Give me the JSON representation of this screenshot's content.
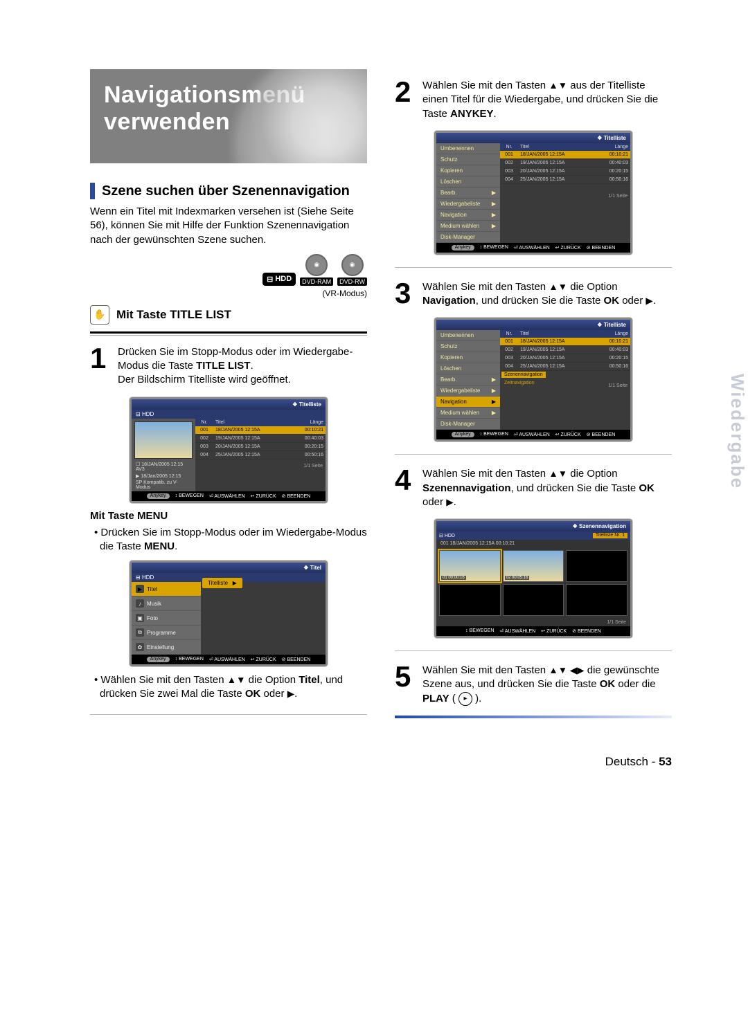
{
  "title_lines": "Navigationsmenü\nverwenden",
  "section": {
    "title": "Szene suchen über Szenennavigation",
    "intro": "Wenn ein Titel mit Indexmarken versehen ist (Siehe Seite 56), können Sie mit Hilfe der Funktion Szenennavigation nach der gewünschten Szene suchen."
  },
  "discs": {
    "hdd": "HDD",
    "ram": "DVD-RAM",
    "rw": "DVD-RW",
    "vr": "(VR-Modus)"
  },
  "subhead": "Mit Taste TITLE LIST",
  "step1": {
    "n": "1",
    "a": "Drücken Sie im Stopp-Modus oder im Wiedergabe-Modus die Taste ",
    "b": "TITLE LIST",
    "c": ".",
    "d": "Der Bildschirm Titelliste wird geöffnet."
  },
  "mock_titlelist": {
    "header": "Titelliste",
    "hdd_label": "HDD",
    "thead": {
      "nr": "Nr.",
      "titel": "Titel",
      "len": "Länge"
    },
    "rows": [
      {
        "nr": "001",
        "t": "18/JAN/2005 12:15A",
        "l": "00:10:21"
      },
      {
        "nr": "002",
        "t": "19/JAN/2005 12:15A",
        "l": "00:40:03"
      },
      {
        "nr": "003",
        "t": "20/JAN/2005 12:15A",
        "l": "00:20:15"
      },
      {
        "nr": "004",
        "t": "25/JAN/2005 12:15A",
        "l": "00:50:16"
      }
    ],
    "cap1": "18/JAN/2005 12:15 AV3",
    "cap2": "18/Jan/2005 12:15",
    "cap3": "SP  Kompatib. zu V-Modus",
    "page": "1/1 Seite",
    "nav": {
      "anykey": "Anykey",
      "bew": "BEWEGEN",
      "aus": "AUSWÄHLEN",
      "zur": "ZURÜCK",
      "end": "BEENDEN"
    }
  },
  "menu_head": "Mit Taste MENU",
  "menu_bullet": "Drücken Sie im Stopp-Modus oder im Wiedergabe-Modus die Taste ",
  "menu_bold": "MENU",
  "mock_menu": {
    "header": "Titel",
    "hdd": "HDD",
    "items": [
      {
        "icon": "▶",
        "label": "Titel",
        "sel": true
      },
      {
        "icon": "♪",
        "label": "Musik"
      },
      {
        "icon": "▣",
        "label": "Foto"
      },
      {
        "icon": "⧉",
        "label": "Programme"
      },
      {
        "icon": "✿",
        "label": "Einstellung"
      }
    ],
    "popup": "Titelliste"
  },
  "menu_bullet2a": "Wählen Sie mit den Tasten ",
  "menu_bullet2b": " die Option ",
  "menu_bullet2c": "Titel",
  "menu_bullet2d": ", und drücken Sie zwei Mal die Taste ",
  "menu_bullet2e": "OK",
  "menu_bullet2f": " oder ",
  "step2": {
    "n": "2",
    "a": "Wählen Sie mit den Tasten ",
    "b": " aus der Titelliste einen Titel für die Wiedergabe, und drücken Sie die Taste ",
    "c": "ANYKEY",
    "d": "."
  },
  "mock_ctx": {
    "header": "Titelliste",
    "items": [
      "Umbenennen",
      "Schutz",
      "Kopieren",
      "Löschen",
      "Bearb.",
      "Wiedergabeliste",
      "Navigation",
      "Medium wählen",
      "Disk-Manager"
    ],
    "arrow_idx": [
      4,
      5,
      6,
      7
    ],
    "page": "1/1 Seite"
  },
  "step3": {
    "n": "3",
    "a": "Wählen Sie mit den Tasten ",
    "b": " die Option ",
    "c": "Navigation",
    "d": ", und drücken Sie die Taste ",
    "e": "OK",
    "f": " oder "
  },
  "mock_nav_sub": {
    "sel": "Navigation",
    "sub1": "Szenennavigation",
    "sub2": "Zeitnavigation"
  },
  "step4": {
    "n": "4",
    "a": "Wählen Sie mit den Tasten ",
    "b": " die Option ",
    "c": "Szenennavigation",
    "d": ", und drücken Sie die Taste ",
    "e": "OK",
    "f": " oder "
  },
  "mock_scene": {
    "header": "Szenennavigation",
    "hdd": "HDD",
    "title_no": "Titelliste Nr.  1",
    "top_date": "001    18/JAN/2005 12:15A   00:10:21",
    "cells": [
      {
        "lbl": "01  00:00:16",
        "img": true,
        "sel": true
      },
      {
        "lbl": "02  00:05:16",
        "img": true
      },
      {
        "lbl": ""
      },
      {
        "lbl": ""
      },
      {
        "lbl": ""
      },
      {
        "lbl": ""
      }
    ],
    "page": "1/1 Seite"
  },
  "step5": {
    "n": "5",
    "a": "Wählen Sie mit den Tasten ",
    "b": " die gewünschte Szene aus, und drücken Sie die Taste ",
    "c": "OK",
    "d": " oder die ",
    "e": "PLAY",
    "f": " ( "
  },
  "sidetab": "Wiedergabe",
  "footer": {
    "lang": "Deutsch",
    "sep": " - ",
    "page": "53"
  },
  "nav_icons": {
    "move": "↕",
    "sel": "⏎",
    "back": "↩",
    "exit": "⏏"
  }
}
